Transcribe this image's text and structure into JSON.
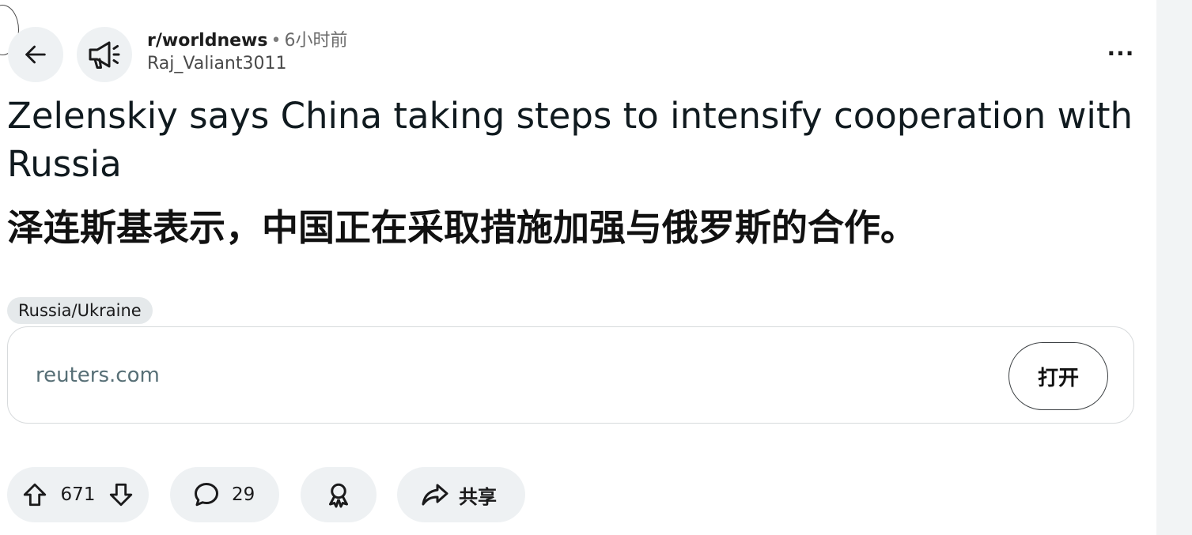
{
  "post": {
    "subreddit": "r/worldnews",
    "separator": "•",
    "time": "6小时前",
    "author": "Raj_Valiant3011",
    "title": "Zelenskiy says China taking steps to intensify cooperation with Russia",
    "title_translation": "泽连斯基表示，中国正在采取措施加强与俄罗斯的合作。",
    "flair": "Russia/Ukraine",
    "link": {
      "domain": "reuters.com",
      "open_label": "打开"
    },
    "actions": {
      "upvotes": "671",
      "comments": "29",
      "share_label": "共享"
    },
    "more_label": "···"
  },
  "icons": {
    "back": "arrow-left-icon",
    "subreddit": "megaphone-icon",
    "upvote": "upvote-arrow-icon",
    "downvote": "downvote-arrow-icon",
    "comment": "speech-bubble-icon",
    "award": "award-ribbon-icon",
    "share": "share-arrow-icon"
  },
  "colors": {
    "pill_background": "#eef1f3",
    "domain_text": "#576f76",
    "flair_background": "#e5e9eb"
  }
}
